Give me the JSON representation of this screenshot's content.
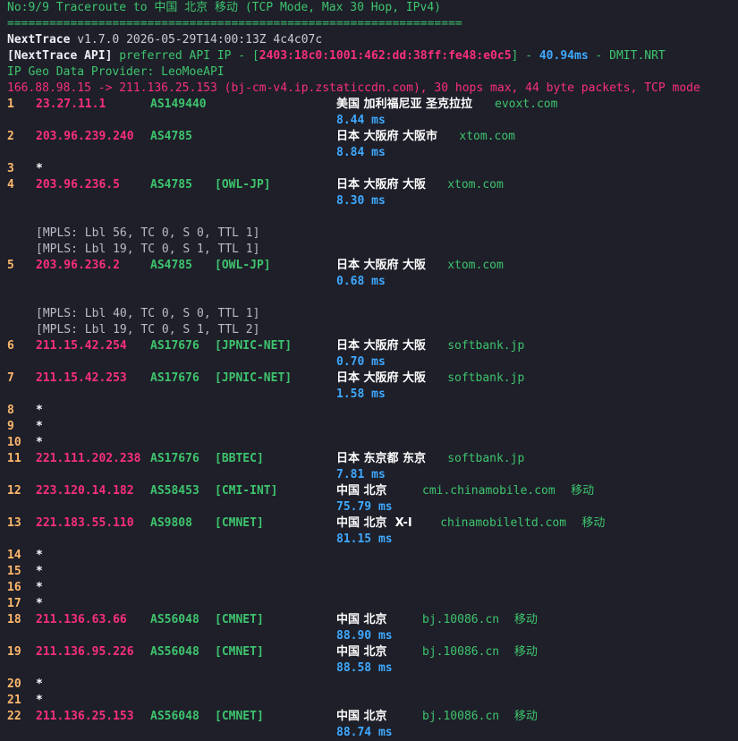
{
  "header": {
    "title": "No:9/9 Traceroute to 中国 北京 移动 (TCP Mode, Max 30 Hop, IPv4)",
    "separator": "=================================================================",
    "app_name": "NextTrace",
    "app_version": "v1.7.0 2026-05-29T14:00:13Z 4c4c07c",
    "api_tag": "[NextTrace API]",
    "api_text": " preferred API IP - [",
    "api_ip": "2403:18c0:1001:462:dd:38ff:fe48:e0c5",
    "api_sep": "] - ",
    "api_ms": "40.94ms",
    "api_node": " - DMIT.NRT",
    "geo_provider": "IP Geo Data Provider: LeoMoeAPI",
    "route_line": "166.88.98.15 -> 211.136.25.153 (bj-cm-v4.ip.zstaticcdn.com), 30 hops max, 44 byte packets, TCP mode"
  },
  "hops": [
    {
      "n": "1",
      "ip": "23.27.11.1",
      "asn": "AS149440",
      "tag": "",
      "geo": "美国 加利福尼亚 圣克拉拉",
      "domain": "evoxt.com",
      "isp": "",
      "rtt": "8.44 ms",
      "mpls": []
    },
    {
      "n": "2",
      "ip": "203.96.239.240",
      "asn": "AS4785",
      "tag": "",
      "geo": "日本 大阪府 大阪市",
      "domain": "xtom.com",
      "isp": "",
      "rtt": "8.84 ms",
      "mpls": []
    },
    {
      "n": "3",
      "star": true
    },
    {
      "n": "4",
      "ip": "203.96.236.5",
      "asn": "AS4785",
      "tag": "[OWL-JP]",
      "geo": "日本 大阪府 大阪",
      "domain": "xtom.com",
      "isp": "",
      "rtt": "8.30 ms",
      "mpls": [
        "[MPLS: Lbl 56, TC 0, S 0, TTL 1]",
        "[MPLS: Lbl 19, TC 0, S 1, TTL 1]"
      ]
    },
    {
      "n": "5",
      "ip": "203.96.236.2",
      "asn": "AS4785",
      "tag": "[OWL-JP]",
      "geo": "日本 大阪府 大阪",
      "domain": "xtom.com",
      "isp": "",
      "rtt": "0.68 ms",
      "mpls": [
        "[MPLS: Lbl 40, TC 0, S 0, TTL 1]",
        "[MPLS: Lbl 19, TC 0, S 1, TTL 2]"
      ]
    },
    {
      "n": "6",
      "ip": "211.15.42.254",
      "asn": "AS17676",
      "tag": "[JPNIC-NET]",
      "geo": "日本 大阪府 大阪",
      "domain": "softbank.jp",
      "isp": "",
      "rtt": "0.70 ms",
      "mpls": []
    },
    {
      "n": "7",
      "ip": "211.15.42.253",
      "asn": "AS17676",
      "tag": "[JPNIC-NET]",
      "geo": "日本 大阪府 大阪",
      "domain": "softbank.jp",
      "isp": "",
      "rtt": "1.58 ms",
      "mpls": []
    },
    {
      "n": "8",
      "star": true
    },
    {
      "n": "9",
      "star": true
    },
    {
      "n": "10",
      "star": true
    },
    {
      "n": "11",
      "ip": "221.111.202.238",
      "asn": "AS17676",
      "tag": "[BBTEC]",
      "geo": "日本 东京都 东京",
      "domain": "softbank.jp",
      "isp": "",
      "rtt": "7.81 ms",
      "mpls": []
    },
    {
      "n": "12",
      "ip": "223.120.14.182",
      "asn": "AS58453",
      "tag": "[CMI-INT]",
      "geo": "中国 北京",
      "domain": "cmi.chinamobile.com",
      "isp": "移动",
      "rtt": "75.79 ms",
      "mpls": []
    },
    {
      "n": "13",
      "ip": "221.183.55.110",
      "asn": "AS9808",
      "tag": "[CMNET]",
      "geo": "中国 北京  X-I",
      "domain": "chinamobileltd.com",
      "isp": "移动",
      "rtt": "81.15 ms",
      "mpls": []
    },
    {
      "n": "14",
      "star": true
    },
    {
      "n": "15",
      "star": true
    },
    {
      "n": "16",
      "star": true
    },
    {
      "n": "17",
      "star": true
    },
    {
      "n": "18",
      "ip": "211.136.63.66",
      "asn": "AS56048",
      "tag": "[CMNET]",
      "geo": "中国 北京",
      "domain": "bj.10086.cn",
      "isp": "移动",
      "rtt": "88.90 ms",
      "mpls": []
    },
    {
      "n": "19",
      "ip": "211.136.95.226",
      "asn": "AS56048",
      "tag": "[CMNET]",
      "geo": "中国 北京",
      "domain": "bj.10086.cn",
      "isp": "移动",
      "rtt": "88.58 ms",
      "mpls": []
    },
    {
      "n": "20",
      "star": true
    },
    {
      "n": "21",
      "star": true
    },
    {
      "n": "22",
      "ip": "211.136.25.153",
      "asn": "AS56048",
      "tag": "[CMNET]",
      "geo": "中国 北京",
      "domain": "bj.10086.cn",
      "isp": "移动",
      "rtt": "88.74 ms",
      "mpls": []
    }
  ],
  "colors": {
    "background": "#1e1f29",
    "ip": "#f92f7b",
    "asn": "#3ec46d",
    "rtt": "#3fa9ff",
    "hop_number": "#ffb86c"
  }
}
